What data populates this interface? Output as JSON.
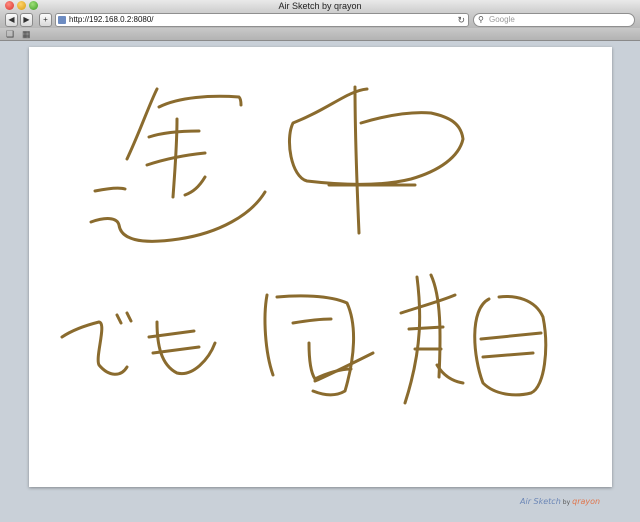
{
  "window": {
    "title": "Air Sketch by qrayon"
  },
  "toolbar": {
    "back_label": "◀",
    "forward_label": "▶",
    "add_label": "+",
    "url": "http://192.168.0.2:8080/",
    "reload_icon": "↻",
    "search_placeholder": "Google"
  },
  "bookmarks": {
    "book_icon": "📖",
    "grid_icon": "▦"
  },
  "canvas": {
    "stroke_color": "#8a6b2e"
  },
  "branding": {
    "app": "Air Sketch",
    "by": "by",
    "maker": "qrayon"
  }
}
